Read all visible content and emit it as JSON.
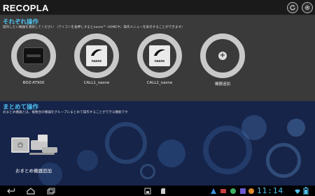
{
  "app": {
    "title": "RECOPLA"
  },
  "section_devices": {
    "title": "それぞれ操作",
    "subtitle": "操作したい機器を選択してください （アイコンを長押しするとnasne™ HOMEや、操作メニューを表示することができます）",
    "devices": [
      {
        "label": "BDZ-AT900",
        "icon": "bd-recorder-icon"
      },
      {
        "label": "CALL1_nasne",
        "icon": "nasne-icon"
      },
      {
        "label": "CALL2_nasne",
        "icon": "nasne-icon"
      },
      {
        "label": "機器追加",
        "icon": "plus-icon"
      }
    ]
  },
  "section_group": {
    "title": "まとめて操作",
    "subtitle": "おまとめ機器とは、複数台の機器をグループにまとめて操作することができる機能です",
    "add_label": "おまとめ機器追加"
  },
  "device_brand": "nasne",
  "statusbar": {
    "time": "11:14"
  },
  "colors": {
    "accent": "#4fc2ef",
    "ring": "#c9c9c9",
    "panel": "#3a3a3a",
    "group_bg": "#16244a"
  }
}
